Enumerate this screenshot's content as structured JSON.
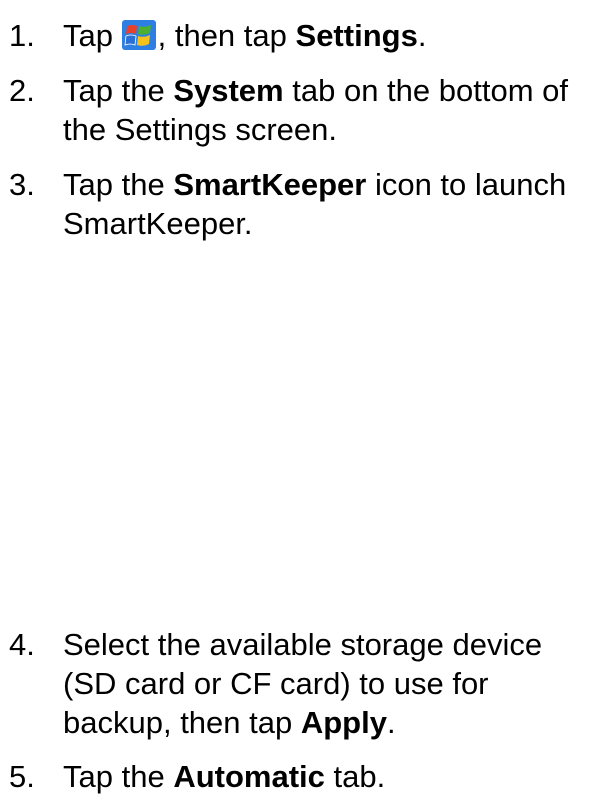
{
  "steps": [
    {
      "number": "1.",
      "line1": {
        "pre": "Tap",
        "icon": "windows-start-icon",
        "mid": ", then tap",
        "bold": "Settings",
        "post": "."
      }
    },
    {
      "number": "2.",
      "line1": {
        "pre": "Tap the",
        "bold": "System",
        "post": "tab on the bottom of"
      },
      "line2": "the Settings screen."
    },
    {
      "number": "3.",
      "line1": {
        "pre": "Tap the",
        "bold": "SmartKeeper",
        "post": "icon to launch"
      },
      "line2": "SmartKeeper."
    },
    {
      "number": "4.",
      "line1": "Select the available storage device",
      "line2": "(SD card or CF card) to use for",
      "line3": {
        "pre": "backup, then tap",
        "bold": "Apply",
        "post": "."
      }
    },
    {
      "number": "5.",
      "line1": {
        "pre": "Tap the",
        "bold": "Automatic",
        "post": "tab."
      }
    }
  ],
  "colors": {
    "text": "#000000",
    "background": "#ffffff",
    "icon_red": "#e8402a",
    "icon_green": "#4caf2f",
    "icon_blue": "#2a6fd6",
    "icon_yellow": "#f5c21b",
    "icon_bg": "#2d7fe3"
  }
}
